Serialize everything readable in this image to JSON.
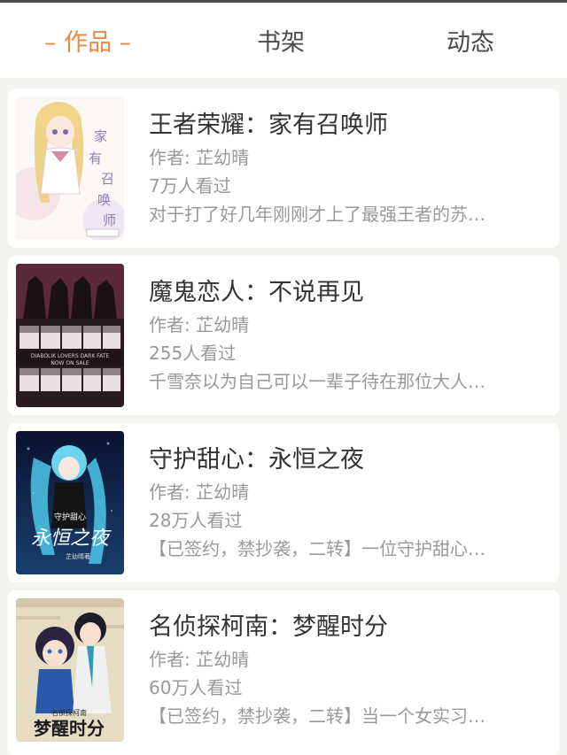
{
  "tabs": [
    {
      "label": "– 作品 –",
      "active": true
    },
    {
      "label": "书架",
      "active": false
    },
    {
      "label": "动态",
      "active": false
    }
  ],
  "colors": {
    "accent": "#e98a46",
    "title": "#333333",
    "meta": "#999999",
    "background": "#f2f2ef"
  },
  "works": [
    {
      "title": "王者荣耀：家有召唤师",
      "author": "作者: 芷幼晴",
      "views": "7万人看过",
      "desc": "对于打了好几年刚刚才上了最强王者的苏…",
      "cover_text": "家有召唤师"
    },
    {
      "title": "魔鬼恋人：不说再见",
      "author": "作者: 芷幼晴",
      "views": "255人看过",
      "desc": "千雪奈以为自己可以一辈子待在那位大人…",
      "cover_text": "DIABOLIK LOVERS DARK FATE NOW ON SALE"
    },
    {
      "title": "守护甜心：永恒之夜",
      "author": "作者: 芷幼晴",
      "views": "28万人看过",
      "desc": "【已签约，禁抄袭，二转】一位守护甜心…",
      "cover_text": "永恒之夜"
    },
    {
      "title": "名侦探柯南：梦醒时分",
      "author": "作者: 芷幼晴",
      "views": "60万人看过",
      "desc": "【已签约，禁抄袭，二转】当一个女实习…",
      "cover_text": "梦醒时分"
    }
  ]
}
